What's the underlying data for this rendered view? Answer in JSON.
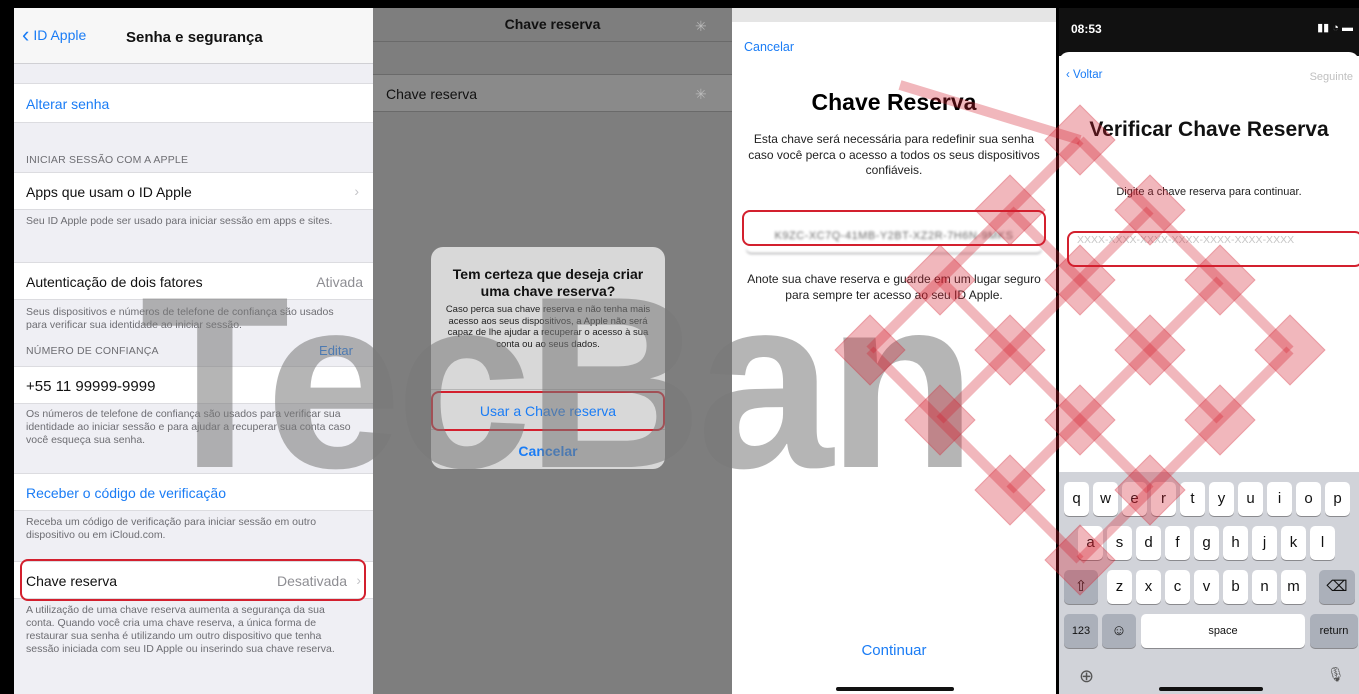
{
  "panel1": {
    "back_label": "ID Apple",
    "nav_title": "Senha e segurança",
    "change_password": "Alterar senha",
    "signin_header": "INICIAR SESSÃO COM A APPLE",
    "apps_label": "Apps que usam o ID Apple",
    "apps_footer": "Seu ID Apple pode ser usado para iniciar sessão em apps e sites.",
    "twofa_label": "Autenticação de dois fatores",
    "twofa_value": "Ativada",
    "twofa_footer": "Seus dispositivos e números de telefone de confiança são usados para verificar sua identidade ao iniciar sessão.",
    "trusted_header": "NÚMERO DE CONFIANÇA",
    "edit_label": "Editar",
    "phone": "+55 11 99999-9999",
    "phone_footer": "Os números de telefone de confiança são usados para verificar sua identidade ao iniciar sessão e para ajudar a recuperar sua conta caso você esqueça sua senha.",
    "get_code": "Receber o código de verificação",
    "code_footer": "Receba um código de verificação para iniciar sessão em outro dispositivo ou em iCloud.com.",
    "recovery_label": "Chave reserva",
    "recovery_value": "Desativada",
    "recovery_footer": "A utilização de uma chave reserva aumenta a segurança da sua conta. Quando você cria uma chave reserva, a única forma de restaurar sua senha é utilizando um outro dispositivo que tenha sessão iniciada com seu ID Apple ou inserindo sua chave reserva."
  },
  "panel2": {
    "nav_title": "Chave reserva",
    "row_label": "Chave reserva",
    "alert_title": "Tem certeza que deseja criar uma chave reserva?",
    "alert_message": "Caso perca sua chave reserva e não tenha mais acesso aos seus dispositivos, a Apple não será capaz de lhe ajudar a recuperar o acesso à sua conta ou ao seus dados.",
    "use_button": "Usar a Chave reserva",
    "cancel_button": "Cancelar"
  },
  "panel3": {
    "cancel": "Cancelar",
    "title": "Chave Reserva",
    "description": "Esta chave será necessária para redefinir sua senha caso você perca o acesso a todos os seus dispositivos confiáveis.",
    "key": "K9ZC-XC7Q-41MB-Y2BT-XZ2R-7H6N-9MKS",
    "note": "Anote sua chave reserva e guarde em um lugar seguro para sempre ter acesso ao seu ID Apple.",
    "continue": "Continuar"
  },
  "panel4": {
    "time": "08:53",
    "status_icons": "▮▮ ◔ ▬",
    "back": "Voltar",
    "next": "Seguinte",
    "title": "Verificar Chave Reserva",
    "subtitle": "Digite a chave reserva para continuar.",
    "placeholder": "XXXX-XXXX-XXXX-XXXX-XXXX-XXXX-XXXX",
    "keyboard": {
      "row1": [
        "q",
        "w",
        "e",
        "r",
        "t",
        "y",
        "u",
        "i",
        "o",
        "p"
      ],
      "row2": [
        "a",
        "s",
        "d",
        "f",
        "g",
        "h",
        "j",
        "k",
        "l"
      ],
      "row3": [
        "z",
        "x",
        "c",
        "v",
        "b",
        "n",
        "m"
      ],
      "shift": "⇧",
      "delete": "⌫",
      "numbers": "123",
      "emoji": "☺",
      "space": "space",
      "return": "return",
      "globe": "⊕",
      "mic": "🎙"
    }
  },
  "watermark": {
    "text": "TecBan",
    "color": "#d3202e"
  },
  "colors": {
    "accent": "#1a7cf5",
    "highlight": "#d3202e"
  }
}
